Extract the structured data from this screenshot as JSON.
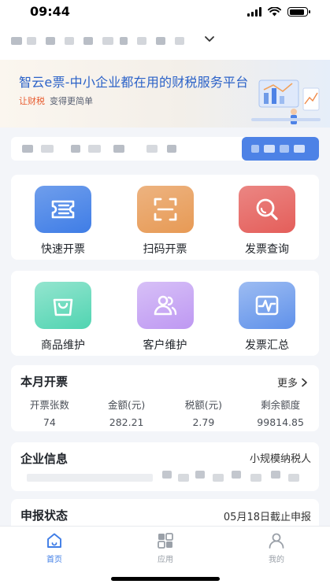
{
  "status_bar": {
    "time": "09:44",
    "battery_level": 0.9
  },
  "company": {
    "name_redacted": true
  },
  "banner": {
    "title": "智云e票-中小企业都在用的财税服务平台",
    "subtitle_accent": "让财税",
    "subtitle_rest": "变得更简单"
  },
  "quick_actions": [
    {
      "label": "快速开票",
      "icon": "ticket-icon",
      "color": "#3f7de6"
    },
    {
      "label": "扫码开票",
      "icon": "scan-icon",
      "color": "#e79a55"
    },
    {
      "label": "发票查询",
      "icon": "search-icon",
      "color": "#e45e5a"
    }
  ],
  "manage_actions": [
    {
      "label": "商品维护",
      "icon": "bag-icon",
      "color": "#3ccfa8"
    },
    {
      "label": "客户维护",
      "icon": "users-icon",
      "color": "#b78df0"
    },
    {
      "label": "发票汇总",
      "icon": "chart-icon",
      "color": "#4d85e8"
    }
  ],
  "monthly": {
    "title": "本月开票",
    "more": "更多",
    "stats": [
      {
        "label": "开票张数",
        "value": "74"
      },
      {
        "label": "金额(元)",
        "value": "282.21"
      },
      {
        "label": "税额(元)",
        "value": "2.79"
      },
      {
        "label": "剩余额度",
        "value": "99814.85"
      }
    ]
  },
  "company_info": {
    "title": "企业信息",
    "taxpayer_type": "小规模纳税人"
  },
  "report": {
    "title": "申报状态",
    "deadline": "05月18日截止申报"
  },
  "tabs": [
    {
      "label": "首页",
      "active": true,
      "color": "#3f7de6"
    },
    {
      "label": "应用",
      "active": false,
      "color": "#9aa0a8"
    },
    {
      "label": "我的",
      "active": false,
      "color": "#9aa0a8"
    }
  ]
}
